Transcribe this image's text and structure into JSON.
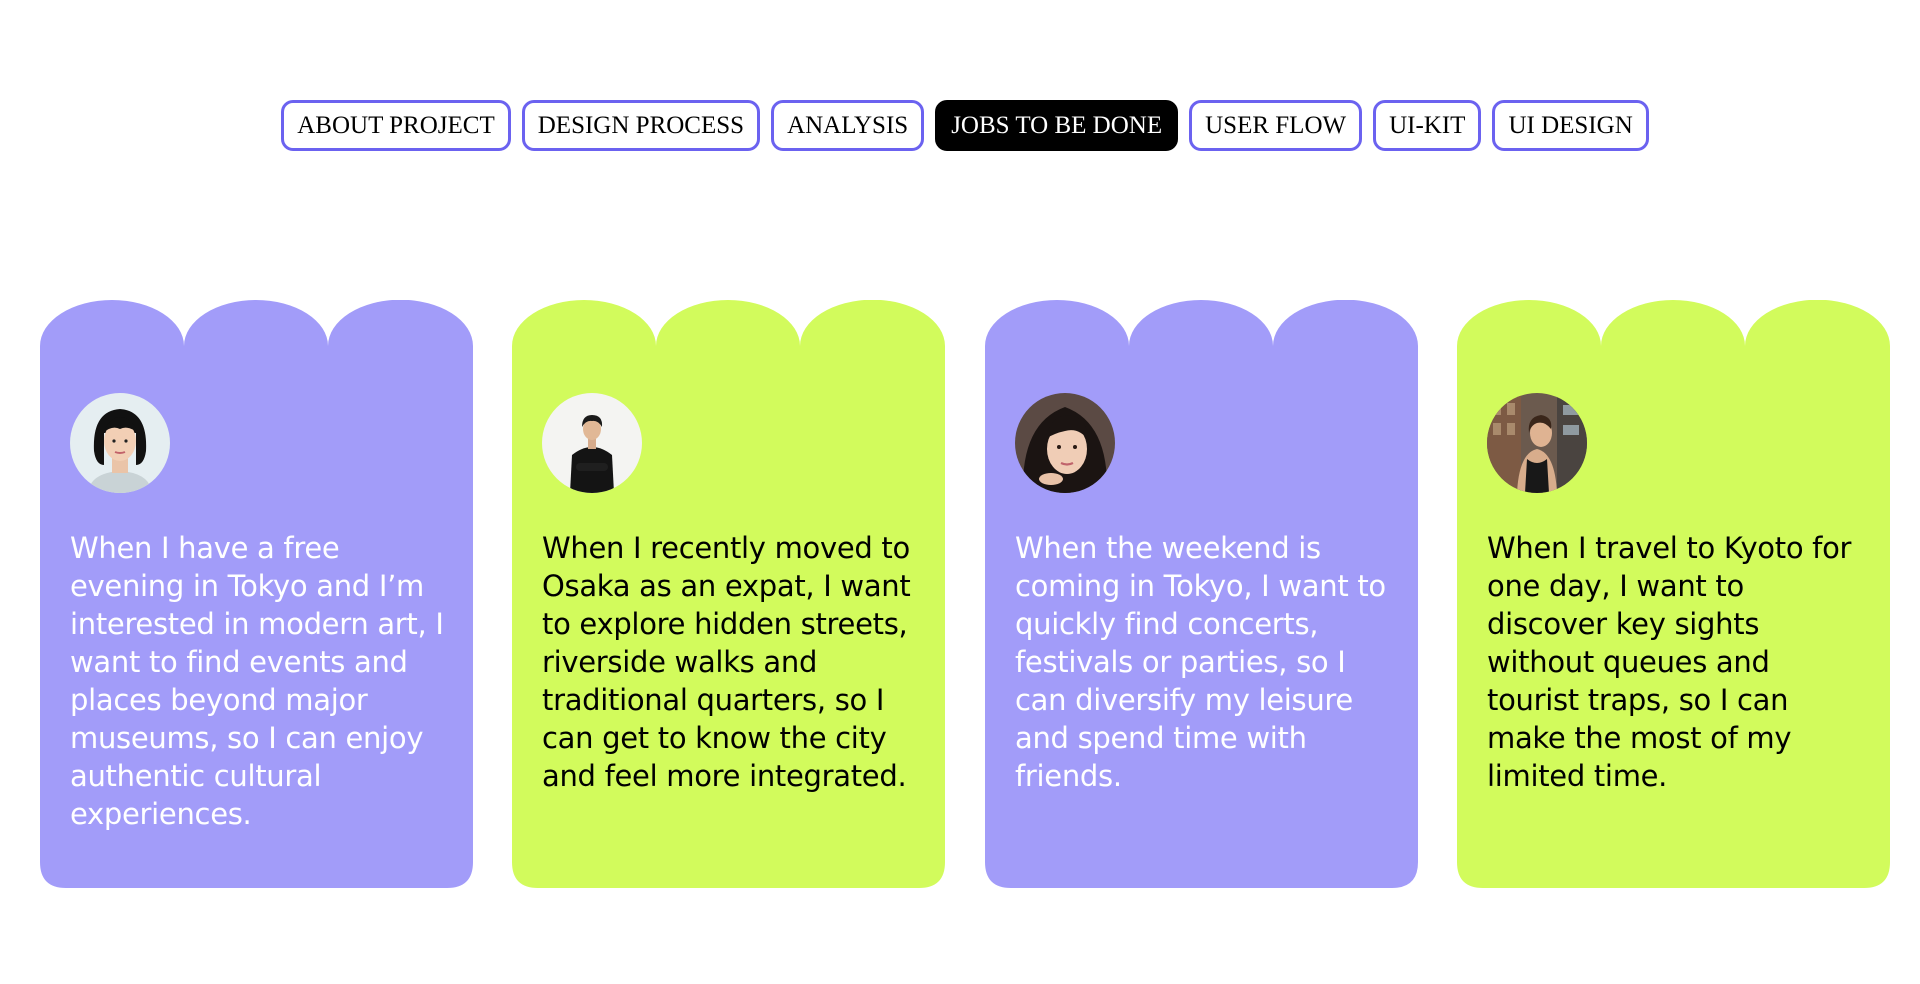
{
  "nav": {
    "tabs": [
      {
        "label": "ABOUT PROJECT",
        "active": false
      },
      {
        "label": "DESIGN PROCESS",
        "active": false
      },
      {
        "label": "ANALYSIS",
        "active": false
      },
      {
        "label": "JOBS TO BE DONE",
        "active": true
      },
      {
        "label": "USER FLOW",
        "active": false
      },
      {
        "label": "UI-KIT",
        "active": false
      },
      {
        "label": "UI DESIGN",
        "active": false
      }
    ]
  },
  "colors": {
    "accent": "#6b62f0",
    "card_purple": "#a29cf9",
    "card_lime": "#d2fb5c",
    "text_light": "#ffffff",
    "text_dark": "#000000"
  },
  "cards": [
    {
      "avatar_icon": "woman-bob-haircut-avatar",
      "text": "When I have a free evening in Tokyo and I’m interested in modern art, I want to find events and places beyond major museums, so I can enjoy authentic cultural experiences."
    },
    {
      "avatar_icon": "man-black-tshirt-avatar",
      "text": "When I recently moved to Osaka as an expat, I want to explore hidden streets, riverside walks and traditional quarters, so I can get to know the city and feel more integrated."
    },
    {
      "avatar_icon": "woman-portrait-avatar",
      "text": "When the weekend is coming in Tokyo, I want to quickly find concerts, festivals or parties, so I can diversify my leisure and spend time with friends."
    },
    {
      "avatar_icon": "woman-city-street-avatar",
      "text": "When I travel to Kyoto for one day, I want to discover key sights without queues and tourist traps, so I can make the most of my limited time."
    }
  ]
}
